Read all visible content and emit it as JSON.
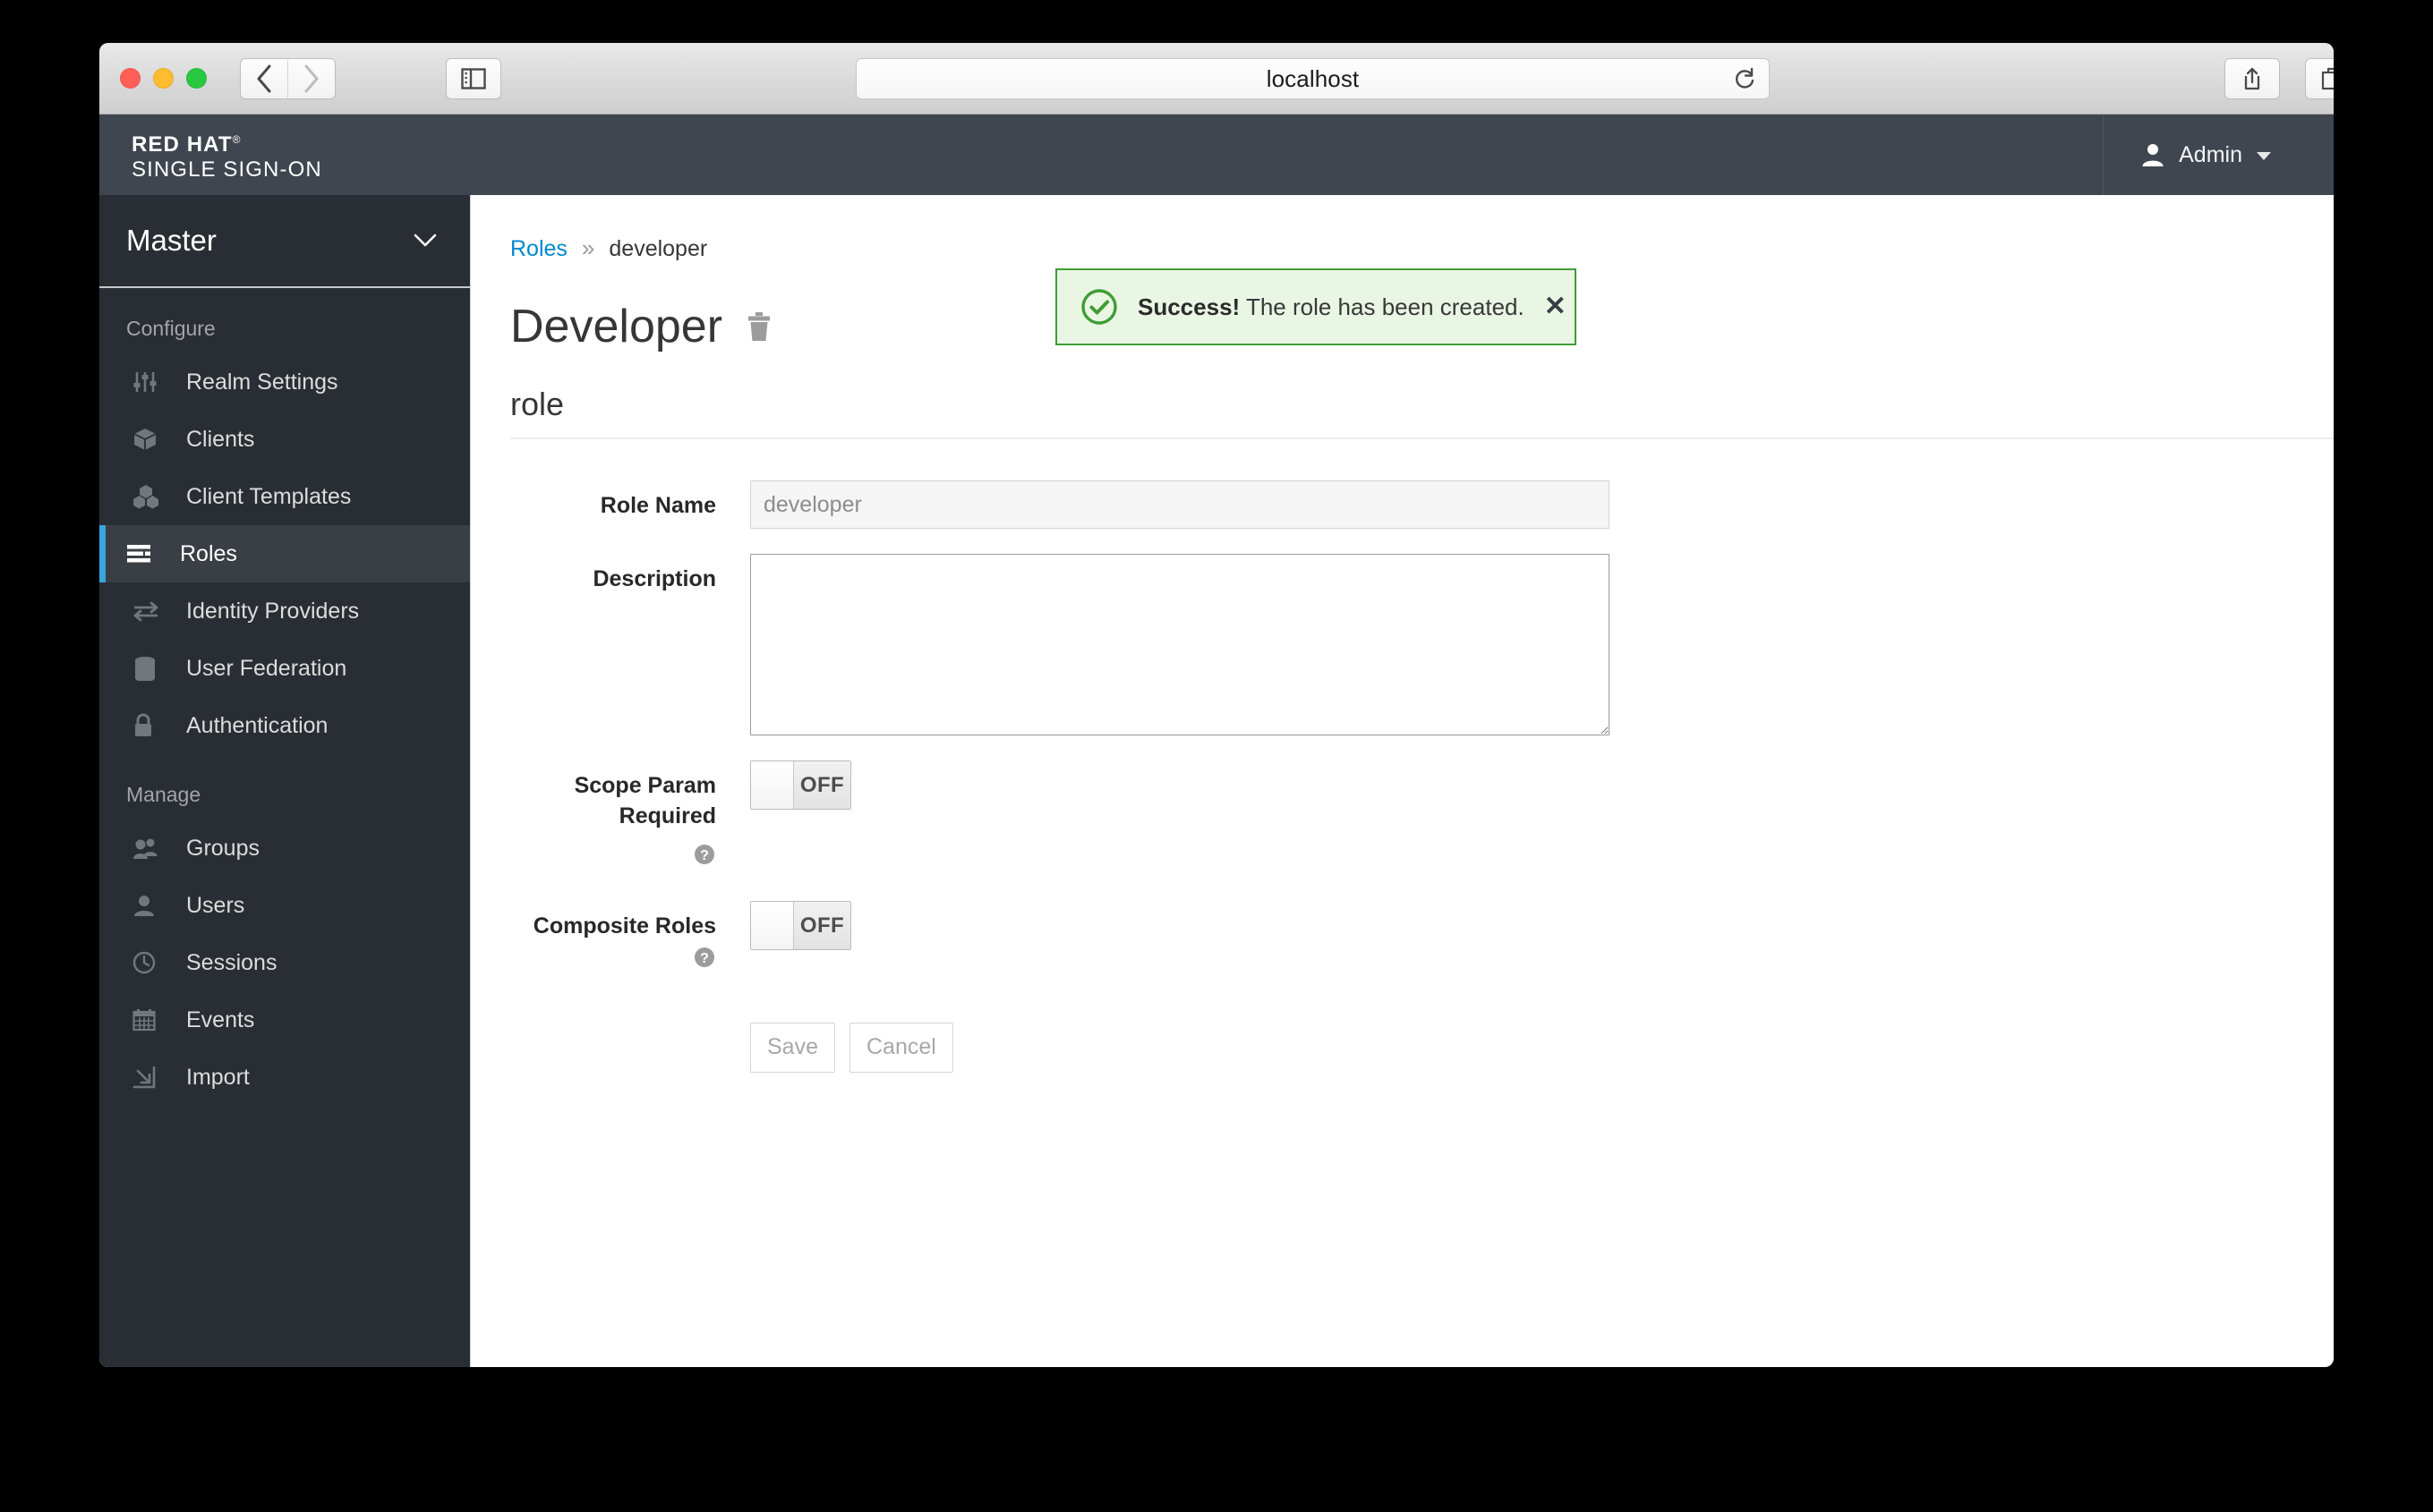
{
  "browser": {
    "url": "localhost",
    "back_icon": "chevron-left-icon",
    "forward_icon": "chevron-right-icon",
    "sidebar_icon": "sidebar-toggle-icon",
    "reload_icon": "reload-icon",
    "share_icon": "share-icon",
    "tabs_icon": "show-tabs-icon",
    "newtab_label": "+"
  },
  "masthead": {
    "brand_bold": "RED HAT",
    "brand_reg": "®",
    "brand_light": "SINGLE SIGN-ON",
    "user_label": "Admin",
    "user_icon": "user-icon"
  },
  "alert": {
    "icon": "check-circle-icon",
    "strong": "Success!",
    "message": "The role has been created.",
    "close_label": "✕",
    "border_color": "#3f9c35",
    "background_color": "#eaf6e4"
  },
  "sidebar": {
    "realm": "Master",
    "realm_caret_icon": "chevron-down-icon",
    "sections": [
      {
        "title": "Configure",
        "items": [
          {
            "label": "Realm Settings",
            "icon": "sliders-icon",
            "active": false
          },
          {
            "label": "Clients",
            "icon": "cube-icon",
            "active": false
          },
          {
            "label": "Client Templates",
            "icon": "cubes-icon",
            "active": false
          },
          {
            "label": "Roles",
            "icon": "list-rows-icon",
            "active": true
          },
          {
            "label": "Identity Providers",
            "icon": "exchange-arrows-icon",
            "active": false
          },
          {
            "label": "User Federation",
            "icon": "database-icon",
            "active": false
          },
          {
            "label": "Authentication",
            "icon": "lock-icon",
            "active": false
          }
        ]
      },
      {
        "title": "Manage",
        "items": [
          {
            "label": "Groups",
            "icon": "users-group-icon",
            "active": false
          },
          {
            "label": "Users",
            "icon": "user-icon",
            "active": false
          },
          {
            "label": "Sessions",
            "icon": "clock-icon",
            "active": false
          },
          {
            "label": "Events",
            "icon": "calendar-icon",
            "active": false
          },
          {
            "label": "Import",
            "icon": "import-arrow-icon",
            "active": false
          }
        ]
      }
    ],
    "active_accent_color": "#39a5dc"
  },
  "main": {
    "breadcrumb": {
      "parent": "Roles",
      "separator": "»",
      "current": "developer"
    },
    "page_title": "Developer",
    "delete_icon": "trash-icon",
    "section_heading": "role",
    "form": {
      "role_name": {
        "label": "Role Name",
        "value": "developer",
        "disabled": true
      },
      "description": {
        "label": "Description",
        "value": "",
        "placeholder": ""
      },
      "scope_param_required": {
        "label": "Scope Param Required",
        "help_icon": "help-circle-icon",
        "state": "OFF"
      },
      "composite_roles": {
        "label": "Composite Roles",
        "help_icon": "help-circle-icon",
        "state": "OFF"
      },
      "save_label": "Save",
      "cancel_label": "Cancel"
    }
  }
}
